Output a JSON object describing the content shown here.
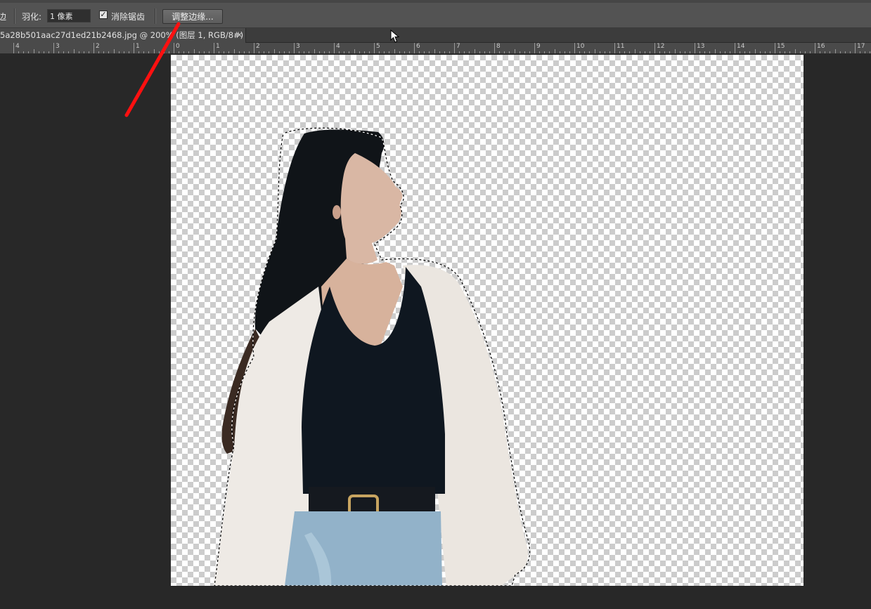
{
  "options_bar": {
    "partial_label": "边",
    "feather_label": "羽化:",
    "feather_value": "1 像素",
    "antialias_checked": true,
    "antialias_label": "消除锯齿",
    "refine_edge_label": "调整边缘..."
  },
  "document_tab": {
    "title": "5a28b501aac27d1ed21b2468.jpg @ 200% (图层 1, RGB/8#) *",
    "close_glyph": "×"
  },
  "ruler": {
    "labels": [
      "4",
      "3",
      "2",
      "1",
      "0",
      "1",
      "2",
      "3",
      "4",
      "5",
      "6",
      "7",
      "8",
      "9",
      "10",
      "11",
      "12",
      "13",
      "14",
      "15",
      "16",
      "17"
    ]
  },
  "icons": {
    "cursor": "arrow-cursor-icon",
    "close": "close-icon",
    "checkbox": "checkmark-icon"
  },
  "colors": {
    "annotation_arrow": "#ff1010",
    "toolbar_bg": "#535353",
    "workspace_bg": "#282828"
  }
}
